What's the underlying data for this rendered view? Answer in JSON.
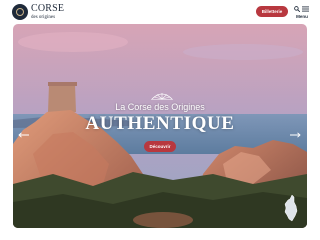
{
  "header": {
    "logo": {
      "line1": "CORSE",
      "line2": "des origines"
    },
    "cta_label": "Billetterie",
    "search_icon": "search-icon",
    "menu_icon": "hamburger-icon",
    "menu_label": "Menu"
  },
  "hero": {
    "subtitle": "La Corse des Origines",
    "title": "AUTHENTIQUE",
    "button_label": "Découvrir",
    "prev_icon": "arrow-left-icon",
    "next_icon": "arrow-right-icon",
    "map_icon": "corsica-island-icon"
  },
  "colors": {
    "accent": "#b8383f",
    "navy": "#1f2a3a",
    "sky_top": "#d7a4b6",
    "sea": "#6a86a8"
  }
}
